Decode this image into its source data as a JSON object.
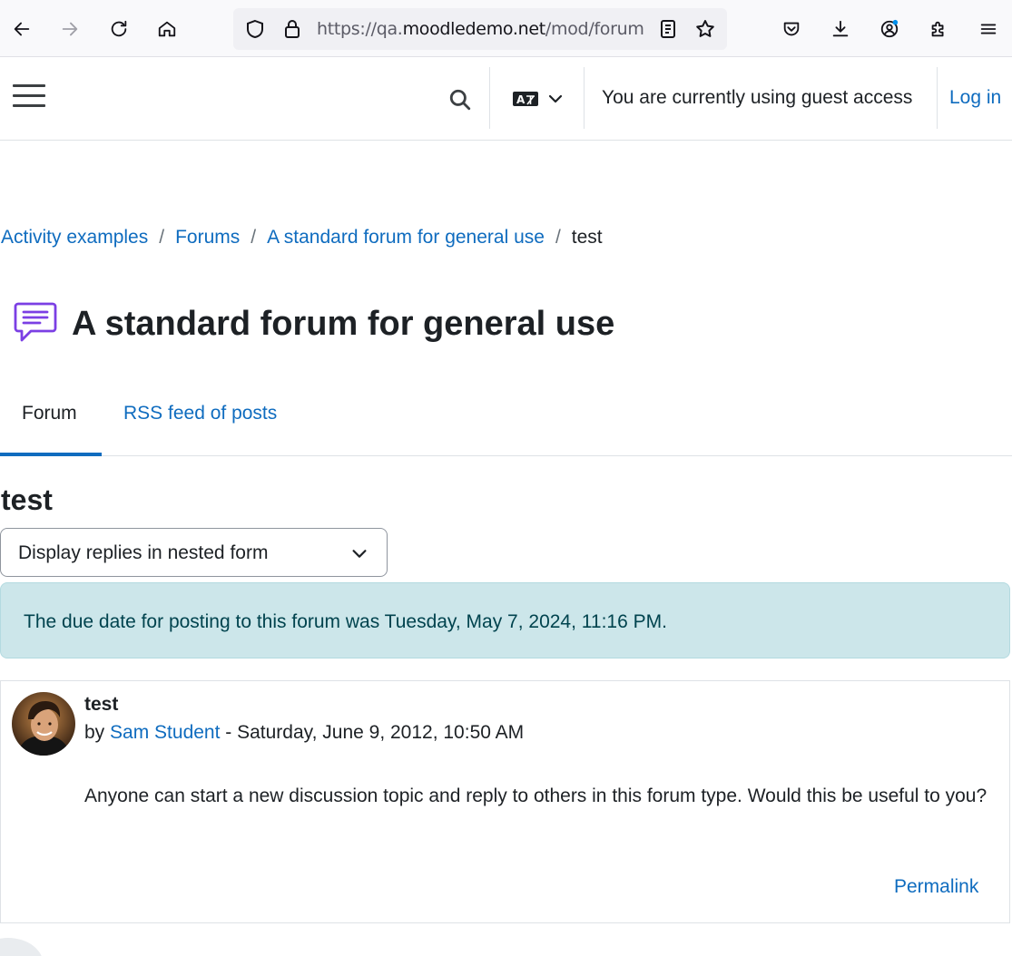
{
  "browser": {
    "url_scheme": "https://qa.",
    "url_host": "moodledemo.net",
    "url_path": "/mod/forum"
  },
  "navbar": {
    "guest_text": "You are currently using guest access",
    "login_label": "Log in"
  },
  "breadcrumb": {
    "items": [
      "Activity examples",
      "Forums",
      "A standard forum for general use"
    ],
    "separator": "/",
    "current": "test"
  },
  "page": {
    "title": "A standard forum for general use"
  },
  "tabs": [
    {
      "label": "Forum",
      "active": true
    },
    {
      "label": "RSS feed of posts",
      "active": false
    }
  ],
  "discussion": {
    "title": "test",
    "display_mode": "Display replies in nested form",
    "due_notice": "The due date for posting to this forum was Tuesday, May 7, 2024, 11:16 PM."
  },
  "post": {
    "subject": "test",
    "by_prefix": "by",
    "author": "Sam Student",
    "date_sep": " - ",
    "date": "Saturday, June 9, 2012, 10:50 AM",
    "body": "Anyone can start a new discussion topic and reply to others in this forum type. Would this be useful to you?",
    "permalink_label": "Permalink"
  },
  "colors": {
    "link": "#0f6cbf",
    "alert_bg": "#cce6ea",
    "forum_icon": "#7b3fe4"
  }
}
